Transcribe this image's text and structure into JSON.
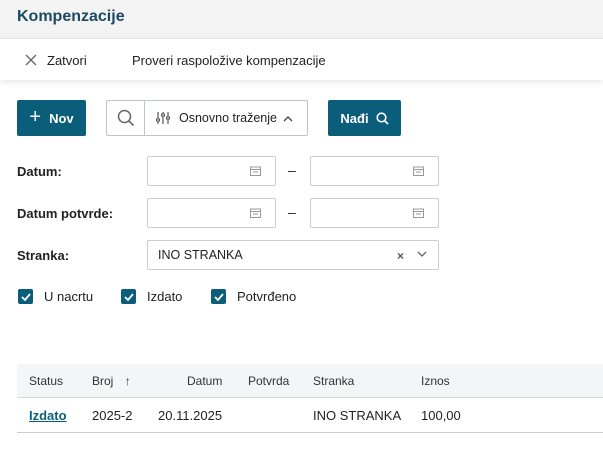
{
  "page": {
    "title": "Kompenzacije"
  },
  "toolbar": {
    "close_label": "Zatvori",
    "check_label": "Proveri raspoložive kompenzacije"
  },
  "actions": {
    "new_label": "Nov",
    "search_mode_label": "Osnovno traženje",
    "find_label": "Nađi"
  },
  "filters": {
    "date_label": "Datum:",
    "confirm_date_label": "Datum potvrde:",
    "range_separator": "–",
    "partner_label": "Stranka:",
    "partner_value": "INO STRANKA",
    "clear_glyph": "×"
  },
  "checkboxes": [
    {
      "label": "U nacrtu",
      "checked": true
    },
    {
      "label": "Izdato",
      "checked": true
    },
    {
      "label": "Potvrđeno",
      "checked": true
    }
  ],
  "table": {
    "columns": [
      "Status",
      "Broj",
      "Datum",
      "Potvrda",
      "Stranka",
      "Iznos"
    ],
    "sort_indicator": "↑",
    "rows": [
      {
        "status": "Izdato",
        "broj": "2025-2",
        "datum": "20.11.2025",
        "potvrda": "",
        "stranka": "INO STRANKA",
        "iznos": "100,00"
      }
    ]
  },
  "colors": {
    "primary": "#0b5e79",
    "title": "#1c4a63"
  }
}
